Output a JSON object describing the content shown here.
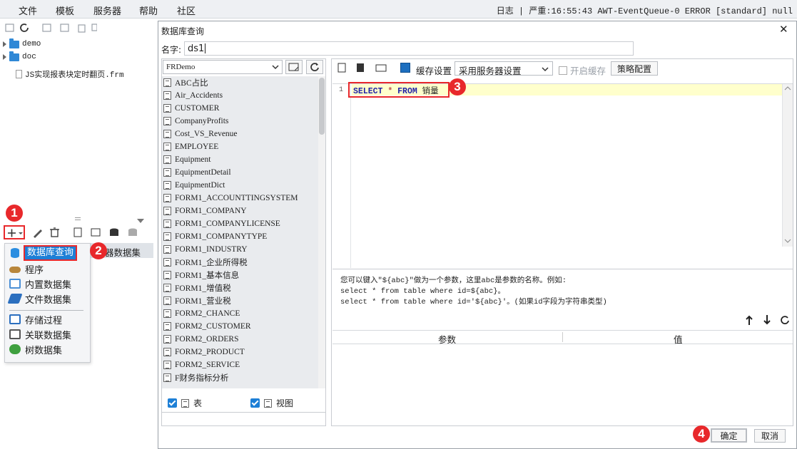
{
  "menu": [
    "文件",
    "模板",
    "服务器",
    "帮助",
    "社区"
  ],
  "status": "日志 | 严重:16:55:43 AWT-EventQueue-0 ERROR [standard] null",
  "tree": {
    "items": [
      {
        "label": "demo",
        "type": "folder"
      },
      {
        "label": "doc",
        "type": "folder"
      },
      {
        "label": "JS实现报表块定时翻页.frm",
        "type": "file"
      }
    ]
  },
  "popup": {
    "items": [
      "数据库查询",
      "程序",
      "内置数据集",
      "文件数据集",
      "存储过程",
      "关联数据集",
      "树数据集"
    ],
    "behind_label": "器数据集"
  },
  "badges": [
    "1",
    "2",
    "3",
    "4"
  ],
  "dialog": {
    "title": "数据库查询",
    "close": "✕",
    "name_label": "名字:",
    "name_value": "ds1",
    "connection": "FRDemo",
    "tables": [
      "ABC占比",
      "Air_Accidents",
      "CUSTOMER",
      "CompanyProfits",
      "Cost_VS_Revenue",
      "EMPLOYEE",
      "Equipment",
      "EquipmentDetail",
      "EquipmentDict",
      "FORM1_ACCOUNTTINGSYSTEM",
      "FORM1_COMPANY",
      "FORM1_COMPANYLICENSE",
      "FORM1_COMPANYTYPE",
      "FORM1_INDUSTRY",
      "FORM1_企业所得税",
      "FORM1_基本信息",
      "FORM1_增值税",
      "FORM1_营业税",
      "FORM2_CHANCE",
      "FORM2_CUSTOMER",
      "FORM2_ORDERS",
      "FORM2_PRODUCT",
      "FORM2_SERVICE",
      "F财务指标分析"
    ],
    "check_table": "表",
    "check_view": "视图",
    "cache_label": "缓存设置",
    "cache_value": "采用服务器设置",
    "open_cache": "开启缓存",
    "strategy": "策略配置",
    "line_no": "1",
    "sql": {
      "select": "SELECT",
      "star": "*",
      "from": "FROM",
      "table": "销量"
    },
    "hint1": "您可以键入\"${abc}\"做为一个参数，这里abc是参数的名称。例如:",
    "hint2": "select * from table where id=${abc}。",
    "hint3": "select * from table where id='${abc}'。(如果id字段为字符串类型)",
    "col_param": "参数",
    "col_value": "值",
    "ok": "确定",
    "cancel": "取消"
  },
  "colors": {
    "accent": "#1d7fd6",
    "badge": "#e8282b",
    "sql_keyword": "#1f1fa8",
    "sql_highlight": "#ffffcc"
  }
}
